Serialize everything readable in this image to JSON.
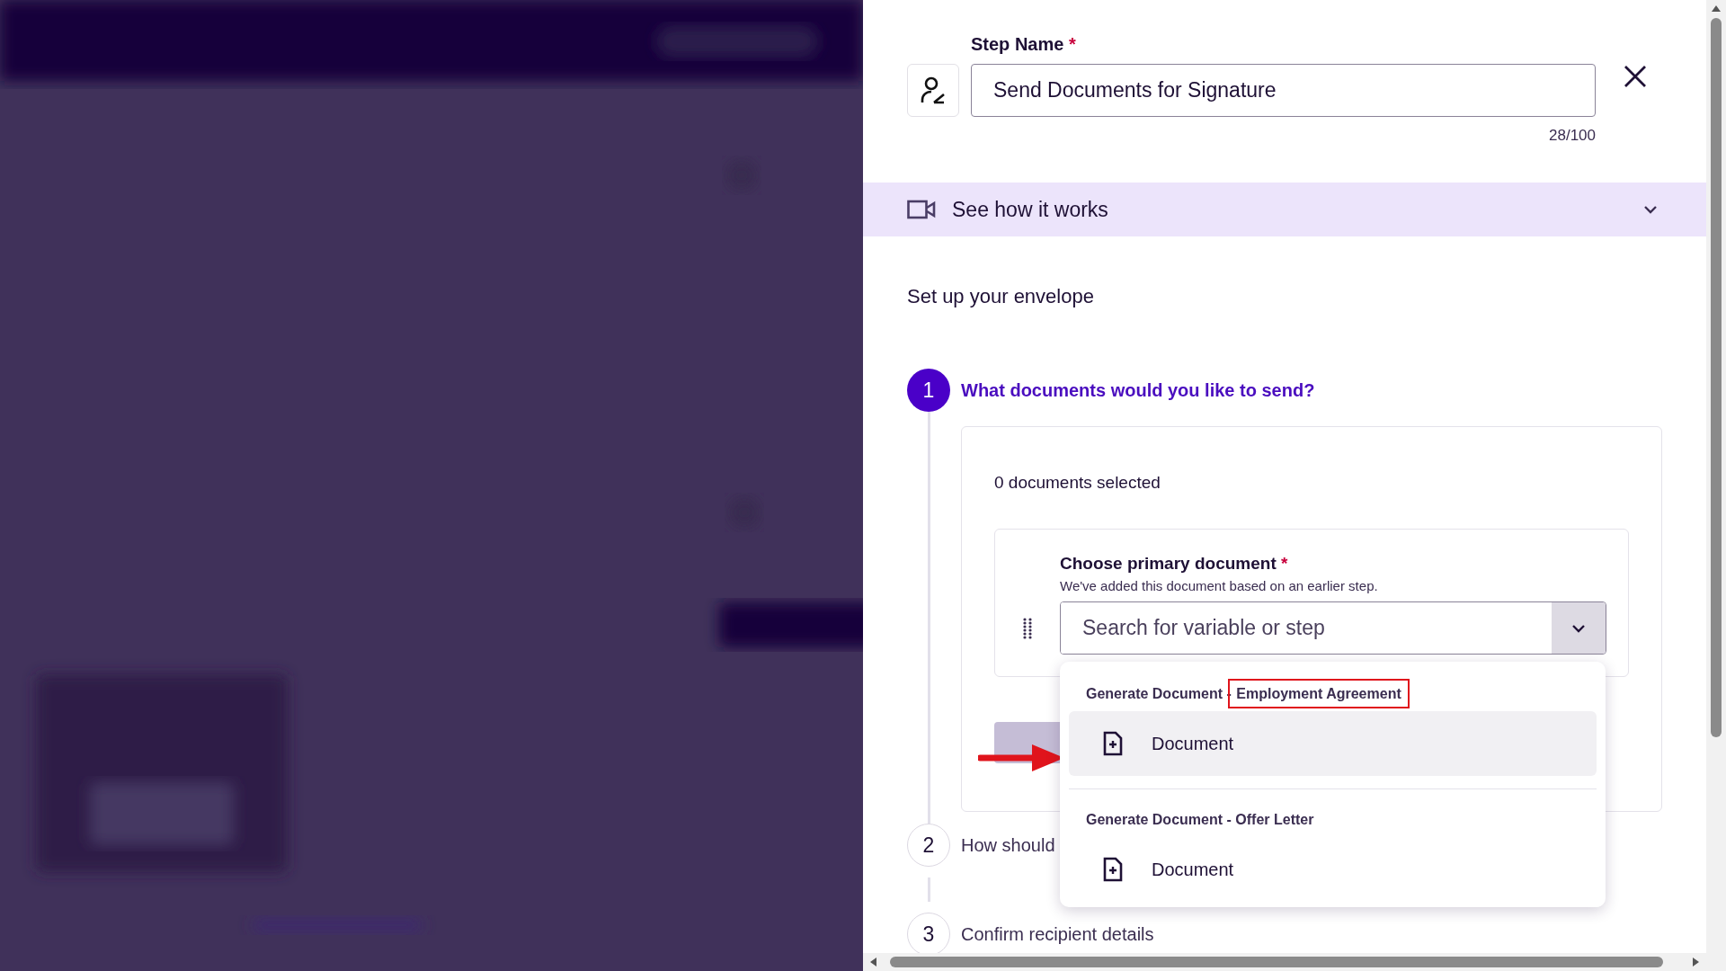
{
  "step_name": {
    "label": "Step Name",
    "required_mark": "*",
    "value": "Send Documents for Signature",
    "counter": "28/100"
  },
  "how_it_works": {
    "label": "See how it works",
    "expanded": false
  },
  "section_title": "Set up your envelope",
  "steps": [
    {
      "number": "1",
      "title": "What documents would you like to send?",
      "active": true
    },
    {
      "number": "2",
      "title": "How should",
      "active": false
    },
    {
      "number": "3",
      "title": "Confirm recipient details",
      "active": false
    }
  ],
  "documents": {
    "count_label": "0 documents selected",
    "primary": {
      "label": "Choose primary document",
      "required_mark": "*",
      "hint": "We've added this document based on an earlier step.",
      "placeholder": "Search for variable or step"
    }
  },
  "dropdown": {
    "groups": [
      {
        "source": "Generate Document",
        "separator": "-",
        "name": "Employment Agreement",
        "highlighted": true,
        "items": [
          {
            "label": "Document",
            "selected": true
          }
        ]
      },
      {
        "source": "Generate Document",
        "separator": "-",
        "name": "Offer Letter",
        "highlighted": false,
        "items": [
          {
            "label": "Document",
            "selected": false
          }
        ]
      }
    ]
  }
}
